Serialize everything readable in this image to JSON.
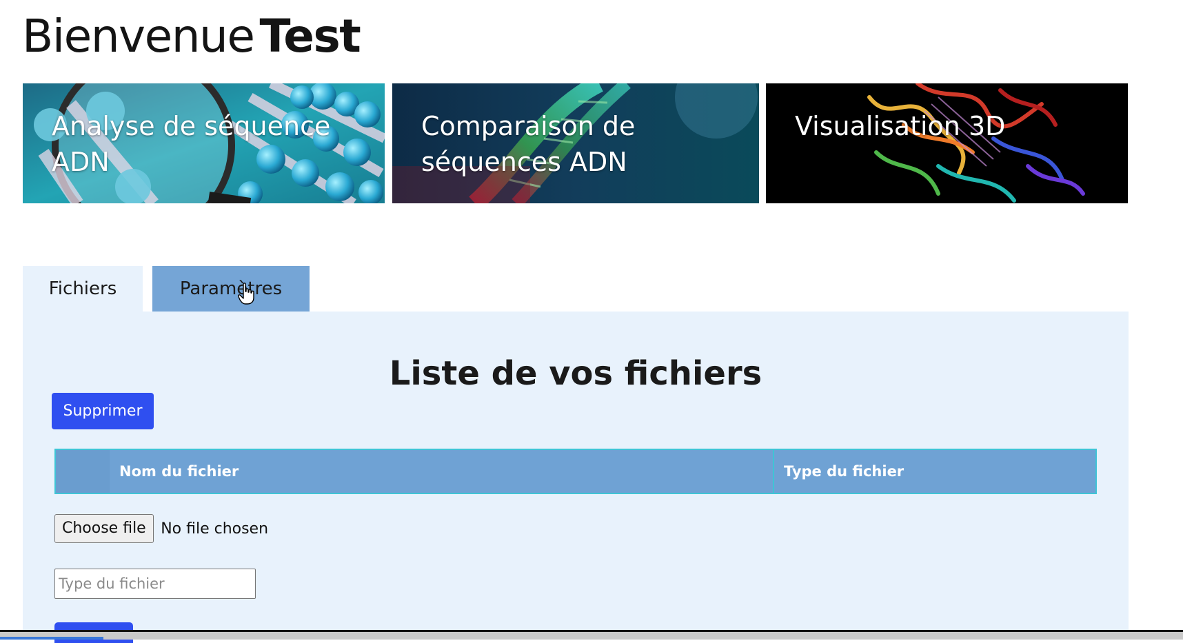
{
  "header": {
    "greeting": "Bienvenue",
    "username": "Test"
  },
  "cards": [
    {
      "title": "Analyse de séquence ADN"
    },
    {
      "title": "Comparaison de séquences ADN"
    },
    {
      "title": "Visualisation 3D"
    }
  ],
  "tabs": [
    {
      "label": "Fichiers",
      "active": true
    },
    {
      "label": "Paramètres",
      "active": false
    }
  ],
  "panel": {
    "title": "Liste de vos fichiers",
    "delete_label": "Supprimer",
    "table": {
      "columns": [
        "Nom du fichier",
        "Type du fichier"
      ]
    },
    "file_input": {
      "button_label": "Choose file",
      "status": "No file chosen"
    },
    "type_input": {
      "placeholder": "Type du fichier",
      "value": ""
    }
  },
  "colors": {
    "primary_button": "#2f4ff0",
    "active_tab_bg": "#e8f2fc",
    "inactive_tab_bg": "#75a5d6",
    "table_header_bg": "#6fa2d4",
    "table_border": "#3fc4d6"
  },
  "icons": {
    "pointer_cursor": "hand-pointer-icon"
  }
}
